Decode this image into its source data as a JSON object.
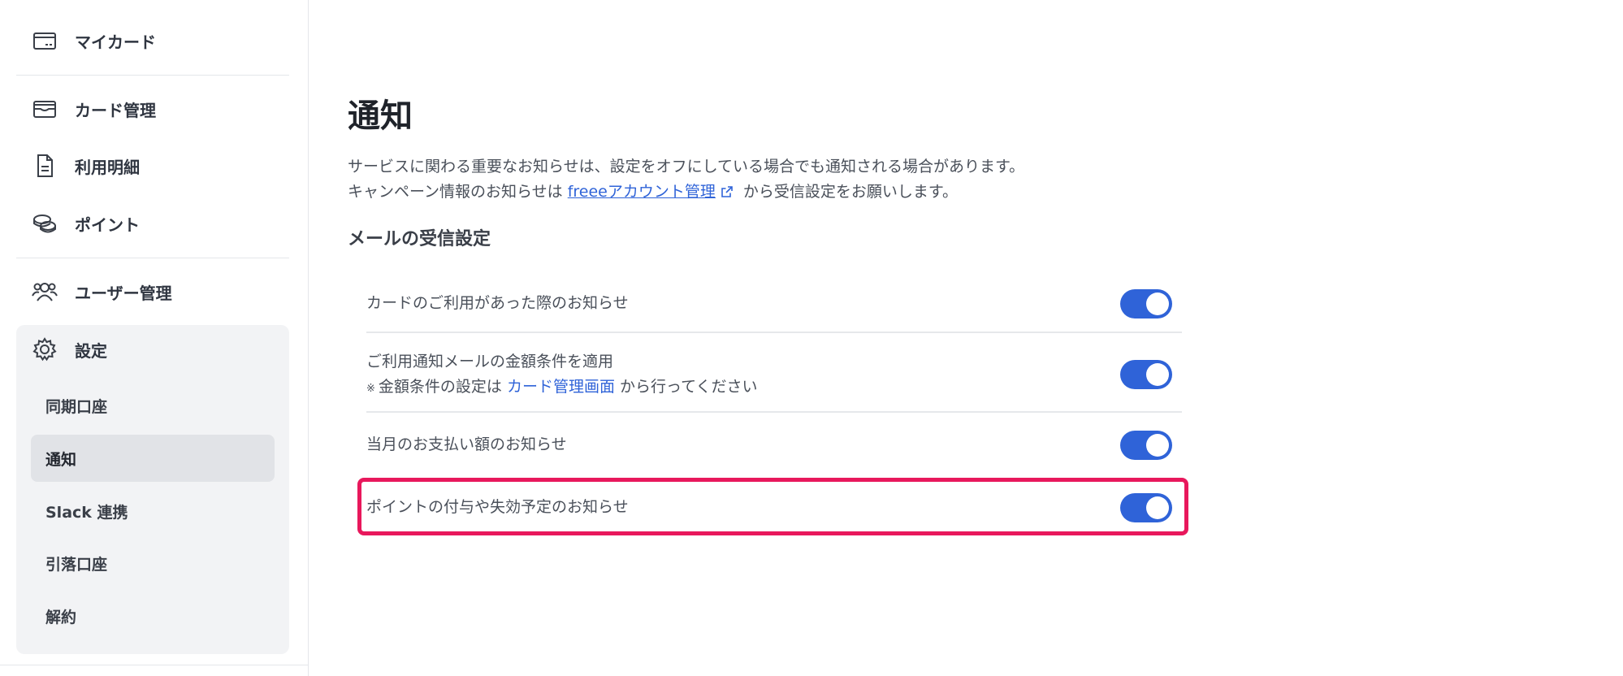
{
  "sidebar": {
    "items": [
      {
        "label": "マイカード",
        "icon": "card-icon"
      },
      {
        "label": "カード管理",
        "icon": "card-manage-icon"
      },
      {
        "label": "利用明細",
        "icon": "document-icon"
      },
      {
        "label": "ポイント",
        "icon": "coins-icon"
      },
      {
        "label": "ユーザー管理",
        "icon": "users-icon"
      },
      {
        "label": "設定",
        "icon": "gear-icon"
      }
    ],
    "settings_subitems": [
      {
        "label": "同期口座",
        "active": false
      },
      {
        "label": "通知",
        "active": true
      },
      {
        "label": "Slack 連携",
        "active": false
      },
      {
        "label": "引落口座",
        "active": false
      },
      {
        "label": "解約",
        "active": false
      }
    ]
  },
  "main": {
    "title": "通知",
    "description_line1": "サービスに関わる重要なお知らせは、設定をオフにしている場合でも通知される場合があります。",
    "description_line2_before": "キャンペーン情報のお知らせは",
    "description_line2_link": "freeeアカウント管理",
    "description_line2_after": "から受信設定をお願いします。",
    "section_title": "メールの受信設定",
    "settings": [
      {
        "label": "カードのご利用があった際のお知らせ",
        "enabled": true
      },
      {
        "label": "ご利用通知メールの金額条件を適用",
        "note_mark": "※",
        "note_before": "金額条件の設定は",
        "note_link": "カード管理画面",
        "note_after": "から行ってください",
        "enabled": true
      },
      {
        "label": "当月のお支払い額のお知らせ",
        "enabled": true
      },
      {
        "label": "ポイントの付与や失効予定のお知らせ",
        "enabled": true,
        "highlighted": true
      }
    ]
  },
  "colors": {
    "accent": "#2f63d8",
    "highlight": "#e8185c"
  }
}
